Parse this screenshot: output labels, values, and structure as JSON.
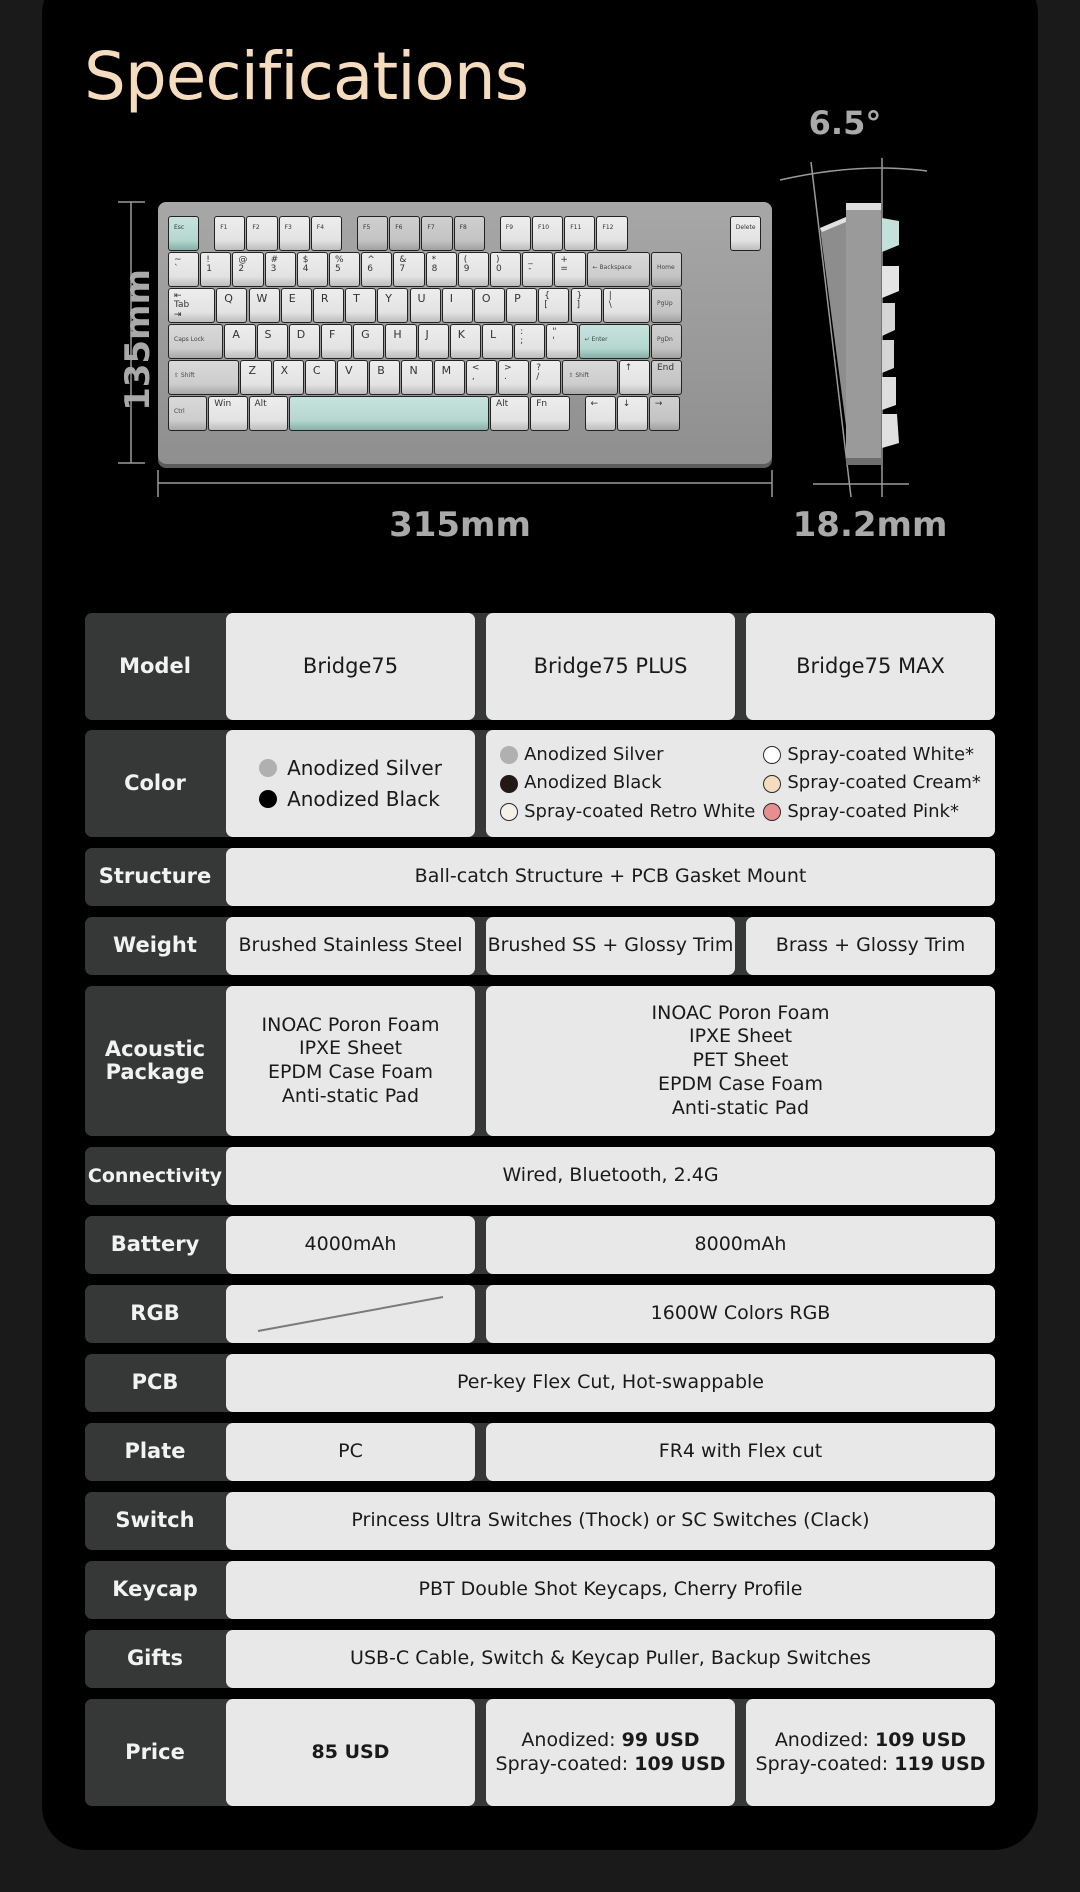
{
  "page": {
    "title": "Specifications",
    "colors": {
      "title": "#f6dcbf",
      "label_bg": "#363837",
      "cell_bg": "#e8e8e8",
      "accent_key": "#b5d7d0"
    }
  },
  "dimensions": {
    "width": "315mm",
    "height": "135mm",
    "depth": "18.2mm",
    "angle": "6.5°"
  },
  "keyboard": {
    "rows": [
      [
        "Esc",
        "F1",
        "F2",
        "F3",
        "F4",
        "F5",
        "F6",
        "F7",
        "F8",
        "F9",
        "F10",
        "F11",
        "F12",
        "Delete"
      ],
      [
        "~\n`",
        "!\n1",
        "@\n2",
        "#\n3",
        "$\n4",
        "%\n5",
        "^\n6",
        "&\n7",
        "*\n8",
        "(\n9",
        ")\n0",
        "_\n-",
        "+\n=",
        "← Backspace",
        "Home"
      ],
      [
        "⇤\nTab\n⇥",
        "Q",
        "W",
        "E",
        "R",
        "T",
        "Y",
        "U",
        "I",
        "O",
        "P",
        "{\n[",
        "}\n]",
        "|\n\\",
        "PgUp"
      ],
      [
        "Caps Lock",
        "A",
        "S",
        "D",
        "F",
        "G",
        "H",
        "J",
        "K",
        "L",
        ":\n;",
        "\"\n'",
        "↵ Enter",
        "PgDn"
      ],
      [
        "⇧ Shift",
        "Z",
        "X",
        "C",
        "V",
        "B",
        "N",
        "M",
        "<\n,",
        ">\n.",
        "?\n/",
        "⇧ Shift",
        "↑",
        "End"
      ],
      [
        "Ctrl",
        "Win",
        "Alt",
        "",
        "Alt",
        "Fn",
        "←",
        "↓",
        "→"
      ]
    ]
  },
  "table": {
    "rows": [
      {
        "label": "Model",
        "cells": [
          "Bridge75",
          "Bridge75 PLUS",
          "Bridge75 MAX"
        ]
      },
      {
        "label": "Color",
        "bridge75_colors": [
          {
            "name": "Anodized Silver",
            "hex": "#b0b0b0"
          },
          {
            "name": "Anodized Black",
            "hex": "#000000"
          }
        ],
        "plus_max_colors": [
          {
            "name": "Anodized Silver",
            "hex": "#b0b0b0"
          },
          {
            "name": "Spray-coated White*",
            "hex": "#ffffff"
          },
          {
            "name": "Anodized Black",
            "hex": "#231815"
          },
          {
            "name": "Spray-coated Cream*",
            "hex": "#f3dcbf"
          },
          {
            "name": "Spray-coated Retro White",
            "hex": "#f5f1ea"
          },
          {
            "name": "Spray-coated Pink*",
            "hex": "#e88e8f"
          }
        ]
      },
      {
        "label": "Structure",
        "cells": [
          "Ball-catch Structure + PCB Gasket Mount"
        ]
      },
      {
        "label": "Weight",
        "cells": [
          "Brushed Stainless Steel",
          "Brushed SS + Glossy Trim",
          "Brass + Glossy Trim"
        ]
      },
      {
        "label": "Acoustic Package",
        "bridge75": [
          "INOAC Poron Foam",
          "IPXE Sheet",
          "EPDM Case Foam",
          "Anti-static Pad"
        ],
        "plus_max": [
          "INOAC Poron Foam",
          "IPXE Sheet",
          "PET Sheet",
          "EPDM Case Foam",
          "Anti-static Pad"
        ]
      },
      {
        "label": "Connectivity",
        "cells": [
          "Wired, Bluetooth, 2.4G"
        ]
      },
      {
        "label": "Battery",
        "cells": [
          "4000mAh",
          "8000mAh"
        ]
      },
      {
        "label": "RGB",
        "cells": [
          "not available",
          "1600W Colors RGB"
        ]
      },
      {
        "label": "PCB",
        "cells": [
          "Per-key Flex Cut, Hot-swappable"
        ]
      },
      {
        "label": "Plate",
        "cells": [
          "PC",
          "FR4 with Flex cut"
        ]
      },
      {
        "label": "Switch",
        "cells": [
          "Princess Ultra Switches (Thock) or SC Switches (Clack)"
        ]
      },
      {
        "label": "Keycap",
        "cells": [
          "PBT Double Shot Keycaps, Cherry Profile"
        ]
      },
      {
        "label": "Gifts",
        "cells": [
          "USB-C Cable, Switch & Keycap Puller, Backup Switches"
        ]
      },
      {
        "label": "Price",
        "bridge75": "85 USD",
        "plus": {
          "anodized_label": "Anodized:",
          "anodized": "99 USD",
          "spray_label": "Spray-coated:",
          "spray": "109 USD"
        },
        "max": {
          "anodized_label": "Anodized:",
          "anodized": "109 USD",
          "spray_label": "Spray-coated:",
          "spray": "119 USD"
        }
      }
    ]
  }
}
